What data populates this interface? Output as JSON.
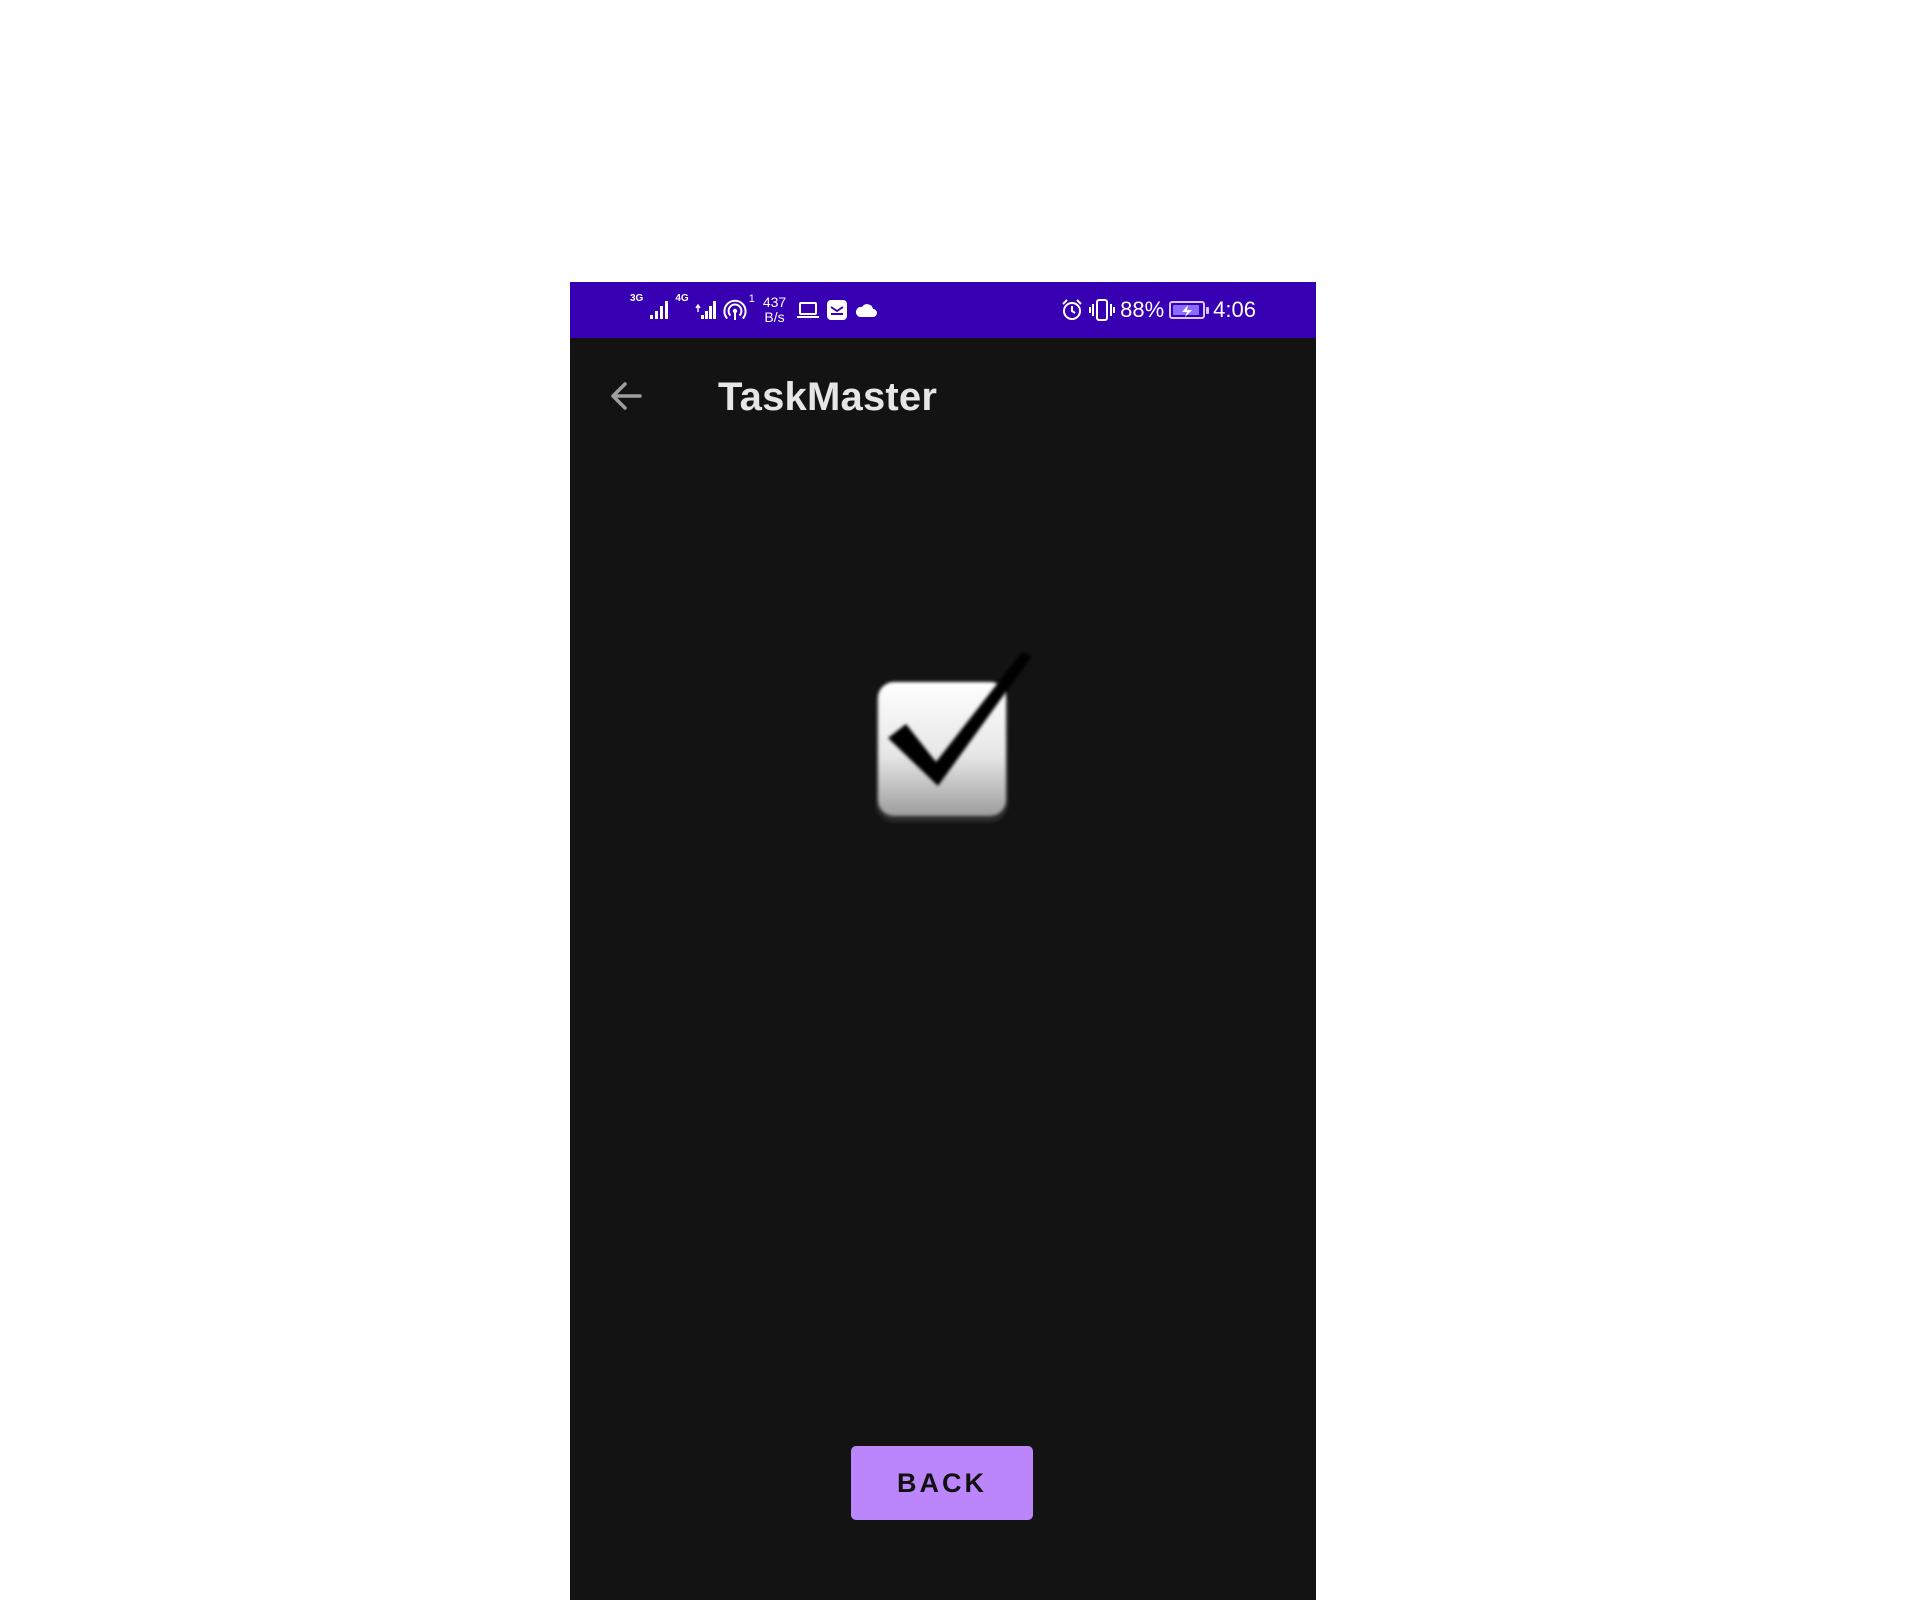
{
  "status_bar": {
    "network1": "3G",
    "network2": "4G",
    "hotspot_count": "1",
    "speed_value": "437",
    "speed_unit": "B/s",
    "battery_percent": "88%",
    "battery_level": 0.88,
    "time": "4:06",
    "background": "#3700b3",
    "icons": [
      "signal-icon",
      "signal-icon",
      "hotspot-icon",
      "laptop-icon",
      "mail-icon",
      "cloud-icon",
      "alarm-icon",
      "vibrate-icon",
      "battery-icon"
    ]
  },
  "app_bar": {
    "title": "TaskMaster",
    "back_icon": "arrow-left-icon"
  },
  "main": {
    "illustration": "checked-checkbox-icon"
  },
  "actions": {
    "back_label": "BACK",
    "accent": "#bb86fc"
  },
  "colors": {
    "background": "#131313",
    "title_text": "#e6e6e6"
  }
}
